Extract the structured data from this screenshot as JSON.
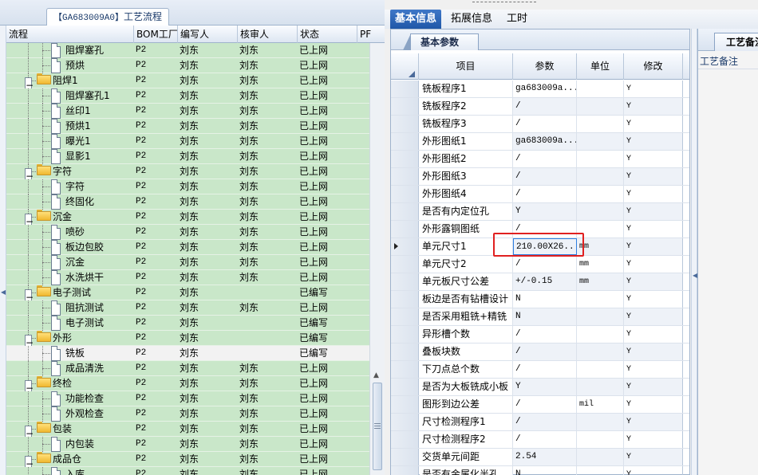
{
  "left_panel": {
    "tab": {
      "code": "【GA683009A0】",
      "title": "工艺流程"
    },
    "columns": [
      "流程",
      "BOM工厂",
      "编写人",
      "核审人",
      "状态",
      "PF"
    ],
    "rows": [
      {
        "label": "阻焊塞孔",
        "level": 2,
        "type": "doc",
        "bom": "P2",
        "writer": "刘东",
        "reviewer": "刘东",
        "status": "已上网"
      },
      {
        "label": "预烘",
        "level": 2,
        "type": "doc",
        "bom": "P2",
        "writer": "刘东",
        "reviewer": "刘东",
        "status": "已上网"
      },
      {
        "label": "阻焊1",
        "level": 1,
        "type": "folder",
        "bom": "P2",
        "writer": "刘东",
        "reviewer": "刘东",
        "status": "已上网"
      },
      {
        "label": "阻焊塞孔1",
        "level": 2,
        "type": "doc",
        "bom": "P2",
        "writer": "刘东",
        "reviewer": "刘东",
        "status": "已上网"
      },
      {
        "label": "丝印1",
        "level": 2,
        "type": "doc",
        "bom": "P2",
        "writer": "刘东",
        "reviewer": "刘东",
        "status": "已上网"
      },
      {
        "label": "预烘1",
        "level": 2,
        "type": "doc",
        "bom": "P2",
        "writer": "刘东",
        "reviewer": "刘东",
        "status": "已上网"
      },
      {
        "label": "曝光1",
        "level": 2,
        "type": "doc",
        "bom": "P2",
        "writer": "刘东",
        "reviewer": "刘东",
        "status": "已上网"
      },
      {
        "label": "显影1",
        "level": 2,
        "type": "doc",
        "bom": "P2",
        "writer": "刘东",
        "reviewer": "刘东",
        "status": "已上网"
      },
      {
        "label": "字符",
        "level": 1,
        "type": "folder",
        "bom": "P2",
        "writer": "刘东",
        "reviewer": "刘东",
        "status": "已上网"
      },
      {
        "label": "字符",
        "level": 2,
        "type": "doc",
        "bom": "P2",
        "writer": "刘东",
        "reviewer": "刘东",
        "status": "已上网"
      },
      {
        "label": "终固化",
        "level": 2,
        "type": "doc",
        "bom": "P2",
        "writer": "刘东",
        "reviewer": "刘东",
        "status": "已上网"
      },
      {
        "label": "沉金",
        "level": 1,
        "type": "folder",
        "bom": "P2",
        "writer": "刘东",
        "reviewer": "刘东",
        "status": "已上网"
      },
      {
        "label": "喷砂",
        "level": 2,
        "type": "doc",
        "bom": "P2",
        "writer": "刘东",
        "reviewer": "刘东",
        "status": "已上网"
      },
      {
        "label": "板边包胶",
        "level": 2,
        "type": "doc",
        "bom": "P2",
        "writer": "刘东",
        "reviewer": "刘东",
        "status": "已上网"
      },
      {
        "label": "沉金",
        "level": 2,
        "type": "doc",
        "bom": "P2",
        "writer": "刘东",
        "reviewer": "刘东",
        "status": "已上网"
      },
      {
        "label": "水洗烘干",
        "level": 2,
        "type": "doc",
        "bom": "P2",
        "writer": "刘东",
        "reviewer": "刘东",
        "status": "已上网"
      },
      {
        "label": "电子测试",
        "level": 1,
        "type": "folder",
        "bom": "P2",
        "writer": "刘东",
        "reviewer": "",
        "status": "已编写"
      },
      {
        "label": "阻抗测试",
        "level": 2,
        "type": "doc",
        "bom": "P2",
        "writer": "刘东",
        "reviewer": "刘东",
        "status": "已上网"
      },
      {
        "label": "电子测试",
        "level": 2,
        "type": "doc",
        "bom": "P2",
        "writer": "刘东",
        "reviewer": "",
        "status": "已编写"
      },
      {
        "label": "外形",
        "level": 1,
        "type": "folder",
        "bom": "P2",
        "writer": "刘东",
        "reviewer": "",
        "status": "已编写"
      },
      {
        "label": "铣板",
        "level": 2,
        "type": "doc",
        "bom": "P2",
        "writer": "刘东",
        "reviewer": "",
        "status": "已编写",
        "selected": true
      },
      {
        "label": "成品清洗",
        "level": 2,
        "type": "doc",
        "bom": "P2",
        "writer": "刘东",
        "reviewer": "刘东",
        "status": "已上网"
      },
      {
        "label": "终检",
        "level": 1,
        "type": "folder",
        "bom": "P2",
        "writer": "刘东",
        "reviewer": "刘东",
        "status": "已上网"
      },
      {
        "label": "功能检查",
        "level": 2,
        "type": "doc",
        "bom": "P2",
        "writer": "刘东",
        "reviewer": "刘东",
        "status": "已上网"
      },
      {
        "label": "外观检查",
        "level": 2,
        "type": "doc",
        "bom": "P2",
        "writer": "刘东",
        "reviewer": "刘东",
        "status": "已上网"
      },
      {
        "label": "包装",
        "level": 1,
        "type": "folder",
        "bom": "P2",
        "writer": "刘东",
        "reviewer": "刘东",
        "status": "已上网"
      },
      {
        "label": "内包装",
        "level": 2,
        "type": "doc",
        "bom": "P2",
        "writer": "刘东",
        "reviewer": "刘东",
        "status": "已上网"
      },
      {
        "label": "成品仓",
        "level": 1,
        "type": "folder",
        "bom": "P2",
        "writer": "刘东",
        "reviewer": "刘东",
        "status": "已上网"
      },
      {
        "label": "入库",
        "level": 2,
        "type": "doc",
        "bom": "P2",
        "writer": "刘东",
        "reviewer": "刘东",
        "status": "已上网"
      }
    ]
  },
  "top_tabs": [
    "基本信息",
    "拓展信息",
    "工时"
  ],
  "sub_tab": "基本参数",
  "param_table": {
    "columns": [
      "项目",
      "参数",
      "单位",
      "修改"
    ],
    "rows": [
      {
        "item": "铣板程序1",
        "param": "ga683009a...",
        "unit": "",
        "mod": "Y"
      },
      {
        "item": "铣板程序2",
        "param": "/",
        "unit": "",
        "mod": "Y"
      },
      {
        "item": "铣板程序3",
        "param": "/",
        "unit": "",
        "mod": "Y"
      },
      {
        "item": "外形图纸1",
        "param": "ga683009a...",
        "unit": "",
        "mod": "Y"
      },
      {
        "item": "外形图纸2",
        "param": "/",
        "unit": "",
        "mod": "Y"
      },
      {
        "item": "外形图纸3",
        "param": "/",
        "unit": "",
        "mod": "Y"
      },
      {
        "item": "外形图纸4",
        "param": "/",
        "unit": "",
        "mod": "Y"
      },
      {
        "item": "是否有内定位孔",
        "param": "Y",
        "unit": "",
        "mod": "Y"
      },
      {
        "item": "外形露铜图纸",
        "param": "/",
        "unit": "",
        "mod": "Y"
      },
      {
        "item": "单元尺寸1",
        "param": "210.00X26...",
        "unit": "mm",
        "mod": "Y",
        "current": true
      },
      {
        "item": "单元尺寸2",
        "param": "/",
        "unit": "mm",
        "mod": "Y"
      },
      {
        "item": "单元板尺寸公差",
        "param": "+/-0.15",
        "unit": "mm",
        "mod": "Y"
      },
      {
        "item": "板边是否有钻槽设计",
        "param": "N",
        "unit": "",
        "mod": "Y"
      },
      {
        "item": "是否采用粗铣+精铣",
        "param": "N",
        "unit": "",
        "mod": "Y"
      },
      {
        "item": "异形槽个数",
        "param": "/",
        "unit": "",
        "mod": "Y"
      },
      {
        "item": "叠板块数",
        "param": "/",
        "unit": "",
        "mod": "Y"
      },
      {
        "item": "下刀点总个数",
        "param": "/",
        "unit": "",
        "mod": "Y"
      },
      {
        "item": "是否为大板铣成小板",
        "param": "Y",
        "unit": "",
        "mod": "Y"
      },
      {
        "item": "图形到边公差",
        "param": "/",
        "unit": "mil",
        "mod": "Y"
      },
      {
        "item": "尺寸检测程序1",
        "param": "/",
        "unit": "",
        "mod": "Y"
      },
      {
        "item": "尺寸检测程序2",
        "param": "/",
        "unit": "",
        "mod": "Y"
      },
      {
        "item": "交货单元间距",
        "param": "2.54",
        "unit": "",
        "mod": "Y"
      },
      {
        "item": "是否有金属化半孔",
        "param": "N",
        "unit": "",
        "mod": "Y"
      }
    ]
  },
  "right_panel": {
    "tab": "工艺备注",
    "label": "工艺备注"
  },
  "colors": {
    "accent": "#1f57a8",
    "row_green": "#c9e7c9",
    "highlight_box": "#e02020"
  }
}
